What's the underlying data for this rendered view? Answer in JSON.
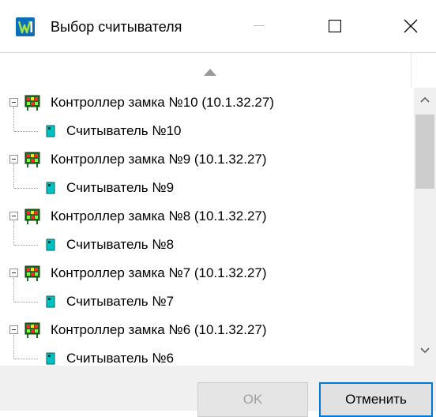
{
  "window": {
    "title": "Выбор считывателя",
    "app_icon": "parsec-logo-icon",
    "controls": [
      "minimize-icon",
      "maximize-icon",
      "close-icon"
    ]
  },
  "tree": {
    "sort_indicator": "sort-ascending-icon",
    "nodes": [
      {
        "controller": "Контроллер замка №10 (10.1.32.27)",
        "reader": "Считыватель №10",
        "expanded": true
      },
      {
        "controller": "Контроллер замка №9 (10.1.32.27)",
        "reader": "Считыватель №9",
        "expanded": true
      },
      {
        "controller": "Контроллер замка №8 (10.1.32.27)",
        "reader": "Считыватель №8",
        "expanded": true
      },
      {
        "controller": "Контроллер замка №7 (10.1.32.27)",
        "reader": "Считыватель №7",
        "expanded": true
      },
      {
        "controller": "Контроллер замка №6 (10.1.32.27)",
        "reader": "Считыватель №6",
        "expanded": true
      }
    ],
    "scrollbar": {
      "position_fraction": 0.0,
      "visible_fraction": 0.33
    }
  },
  "buttons": {
    "ok_label": "OK",
    "ok_enabled": false,
    "cancel_label": "Отменить"
  },
  "colors": {
    "accent": "#0078d7",
    "reader_icon": "#00c0c0",
    "controller_icon": "#1f6b1f"
  }
}
